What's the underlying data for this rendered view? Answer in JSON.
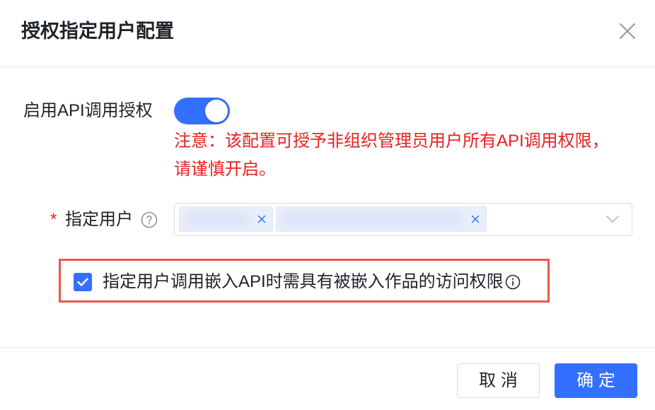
{
  "dialog": {
    "title": "授权指定用户配置"
  },
  "api_auth": {
    "label": "启用API调用授权",
    "enabled": true,
    "warning_lines": [
      "注意：该配置可授予非组织管理员用户所有API调用权限，",
      "请谨慎开启。"
    ]
  },
  "assigned_users": {
    "required_mark": "*",
    "label": "指定用户"
  },
  "embed_permission": {
    "checked": true,
    "label": "指定用户调用嵌入API时需具有被嵌入作品的访问权限"
  },
  "footer": {
    "cancel_label": "取 消",
    "confirm_label": "确 定"
  },
  "icons": {
    "close": "close-icon",
    "help": "question-circle-icon",
    "tag_remove": "close-icon",
    "dropdown": "chevron-down-icon",
    "check": "check-icon",
    "info": "info-circle-icon"
  },
  "colors": {
    "primary": "#3370ff",
    "danger": "#e82121",
    "highlight_border": "#e8574e",
    "text": "#1f2329",
    "muted": "#8f959e",
    "border": "#d9dbde",
    "divider": "#ebecee",
    "tag_bg": "#e9eefb"
  }
}
